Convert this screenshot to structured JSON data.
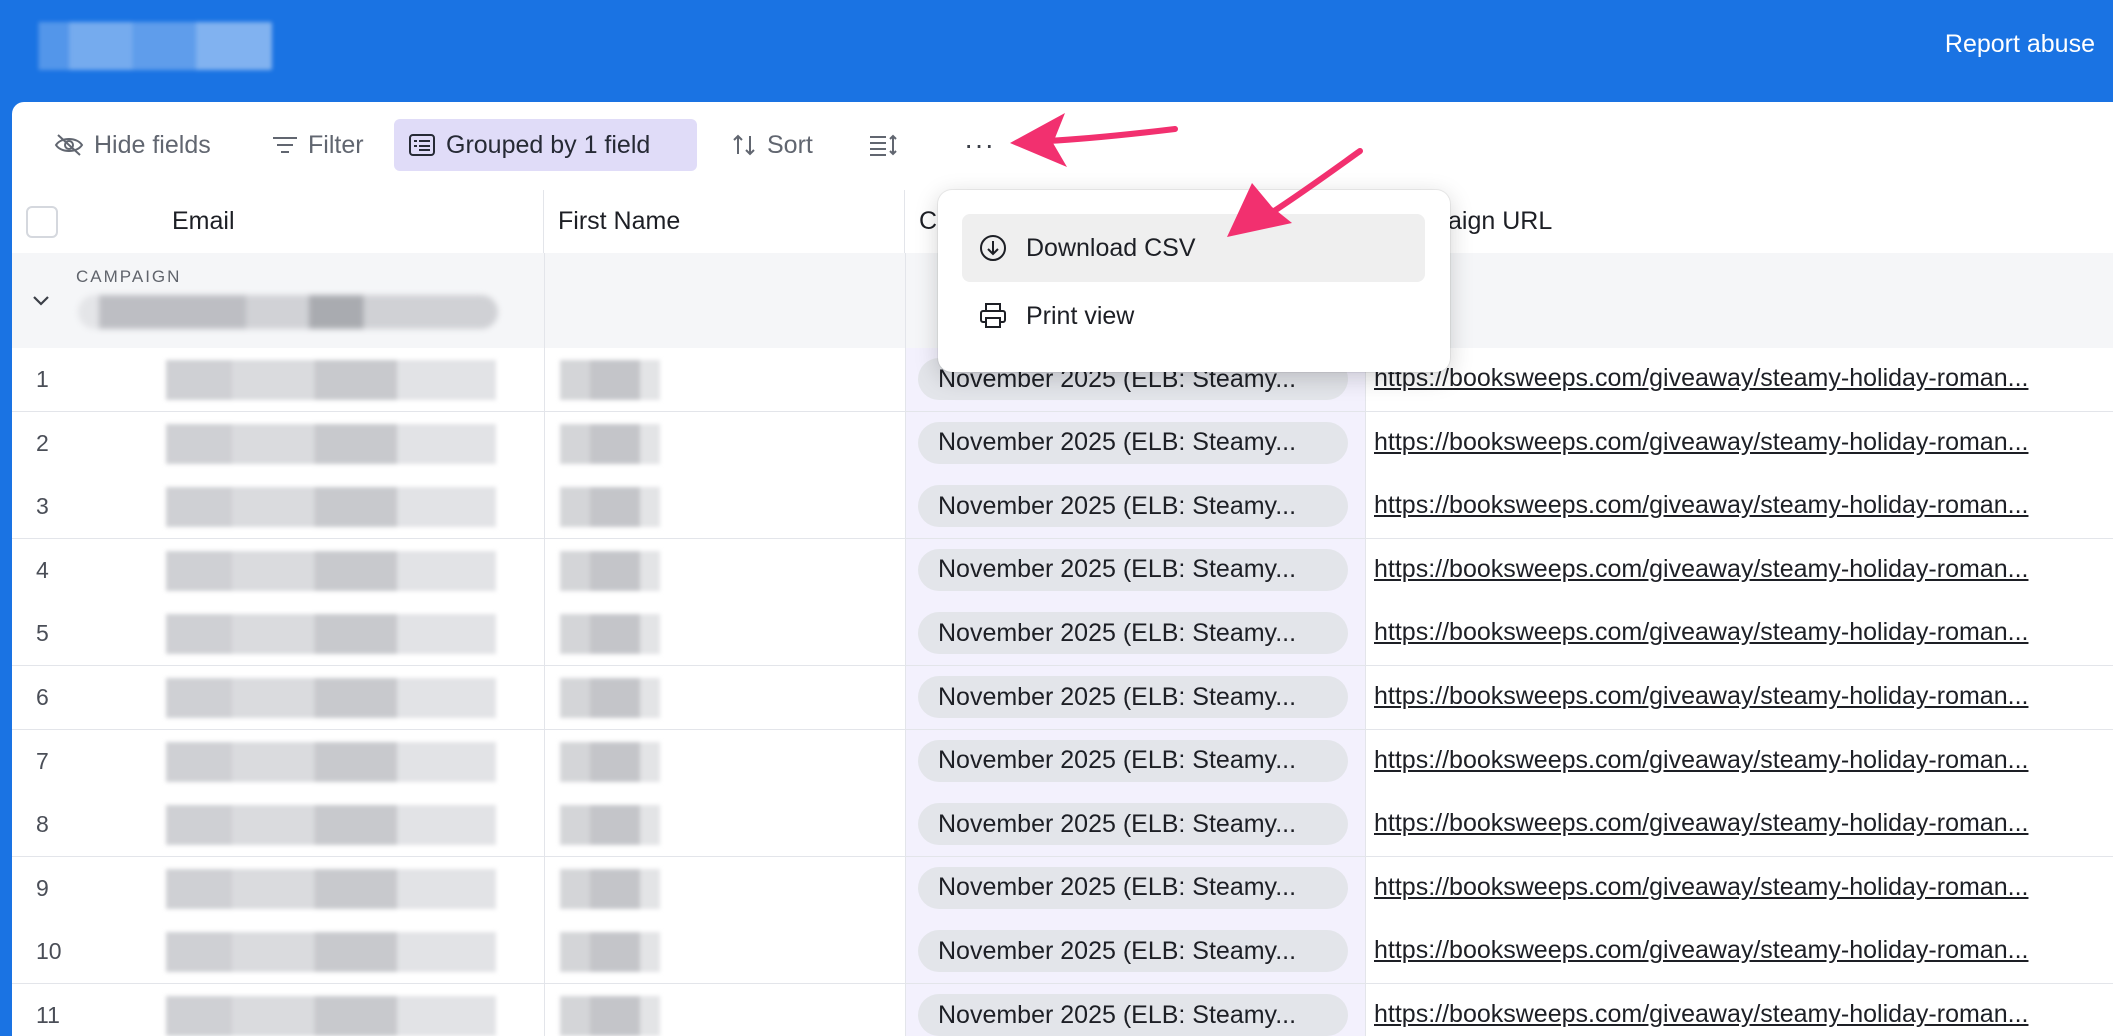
{
  "topbar": {
    "report_abuse": "Report abuse"
  },
  "toolbar": {
    "hide_fields": "Hide fields",
    "filter": "Filter",
    "grouped": "Grouped by 1 field",
    "sort": "Sort",
    "more": "···"
  },
  "columns": {
    "email": "Email",
    "first_name": "First Name",
    "campaign_partial": "C",
    "campaign_url_partial": "aign URL"
  },
  "group": {
    "label": "CAMPAIGN"
  },
  "menu": {
    "items": [
      {
        "label": "Download CSV",
        "icon": "download-icon"
      },
      {
        "label": "Print view",
        "icon": "printer-icon"
      }
    ]
  },
  "rows": [
    {
      "num": "1",
      "campaign": "November 2025 (ELB: Steamy...",
      "url": "https://booksweeps.com/giveaway/steamy-holiday-roman..."
    },
    {
      "num": "2",
      "campaign": "November 2025 (ELB: Steamy...",
      "url": "https://booksweeps.com/giveaway/steamy-holiday-roman..."
    },
    {
      "num": "3",
      "campaign": "November 2025 (ELB: Steamy...",
      "url": "https://booksweeps.com/giveaway/steamy-holiday-roman..."
    },
    {
      "num": "4",
      "campaign": "November 2025 (ELB: Steamy...",
      "url": "https://booksweeps.com/giveaway/steamy-holiday-roman..."
    },
    {
      "num": "5",
      "campaign": "November 2025 (ELB: Steamy...",
      "url": "https://booksweeps.com/giveaway/steamy-holiday-roman..."
    },
    {
      "num": "6",
      "campaign": "November 2025 (ELB: Steamy...",
      "url": "https://booksweeps.com/giveaway/steamy-holiday-roman..."
    },
    {
      "num": "7",
      "campaign": "November 2025 (ELB: Steamy...",
      "url": "https://booksweeps.com/giveaway/steamy-holiday-roman..."
    },
    {
      "num": "8",
      "campaign": "November 2025 (ELB: Steamy...",
      "url": "https://booksweeps.com/giveaway/steamy-holiday-roman..."
    },
    {
      "num": "9",
      "campaign": "November 2025 (ELB: Steamy...",
      "url": "https://booksweeps.com/giveaway/steamy-holiday-roman..."
    },
    {
      "num": "10",
      "campaign": "November 2025 (ELB: Steamy...",
      "url": "https://booksweeps.com/giveaway/steamy-holiday-roman..."
    },
    {
      "num": "11",
      "campaign": "November 2025 (ELB: Steamy...",
      "url": "https://booksweeps.com/giveaway/steamy-holiday-roman..."
    }
  ],
  "colors": {
    "topbar": "#1a73e3",
    "grouped_bg": "#e0dcf8",
    "annotation_arrow": "#f2306f"
  }
}
